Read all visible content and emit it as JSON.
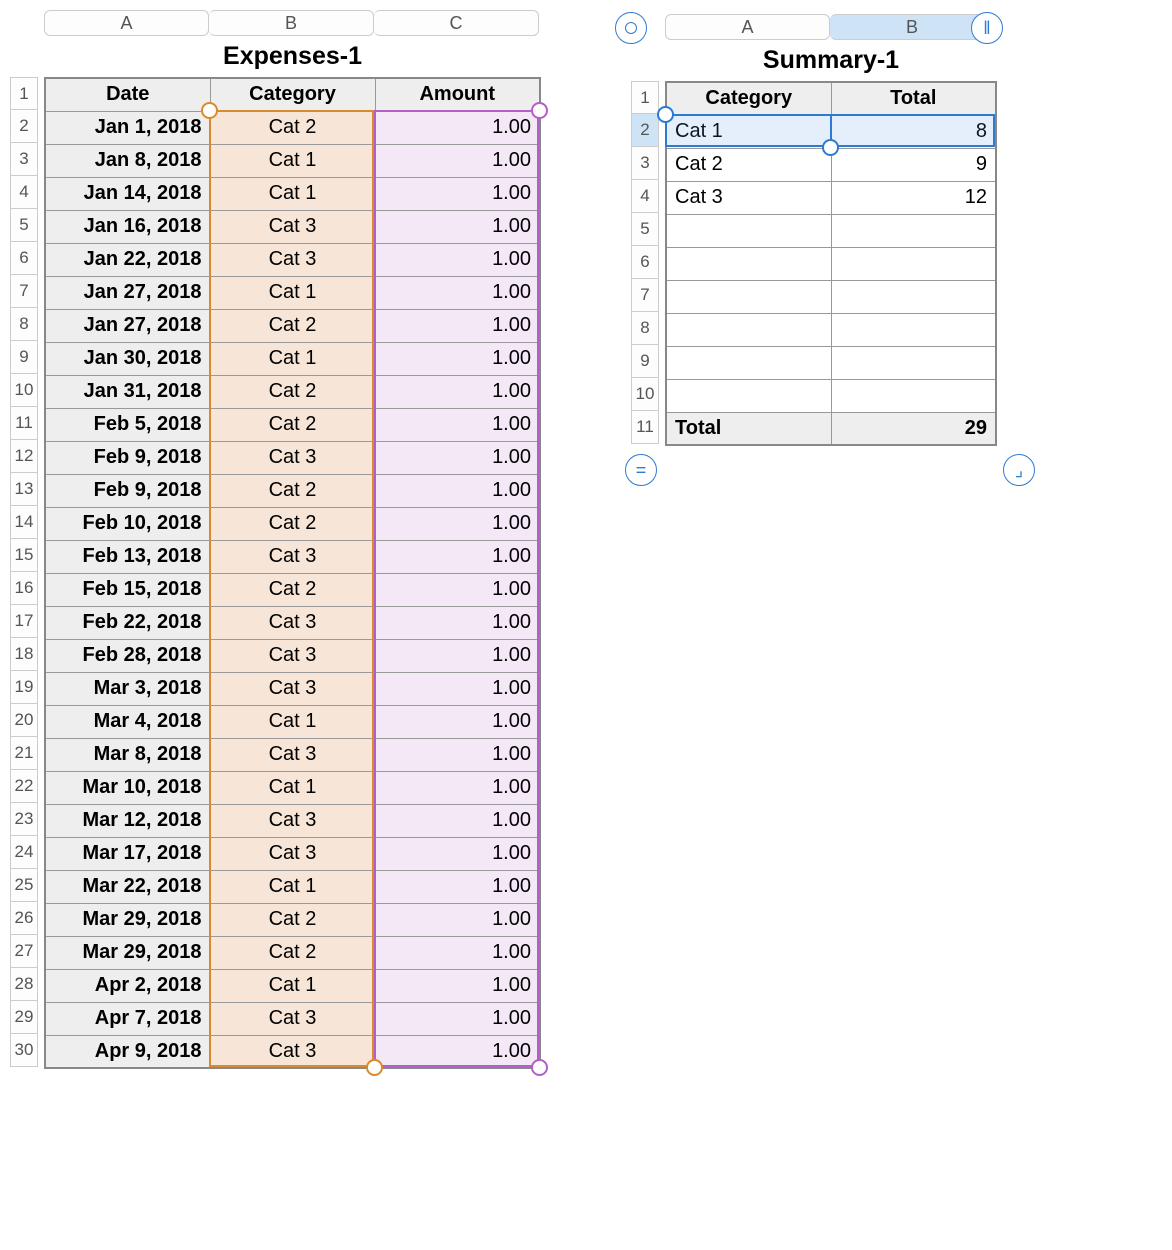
{
  "expenses": {
    "title": "Expenses-1",
    "colLetters": [
      "A",
      "B",
      "C"
    ],
    "headers": [
      "Date",
      "Category",
      "Amount"
    ],
    "rows": [
      {
        "date": "Jan 1, 2018",
        "cat": "Cat 2",
        "amt": "1.00"
      },
      {
        "date": "Jan 8, 2018",
        "cat": "Cat 1",
        "amt": "1.00"
      },
      {
        "date": "Jan 14, 2018",
        "cat": "Cat 1",
        "amt": "1.00"
      },
      {
        "date": "Jan 16, 2018",
        "cat": "Cat 3",
        "amt": "1.00"
      },
      {
        "date": "Jan 22, 2018",
        "cat": "Cat 3",
        "amt": "1.00"
      },
      {
        "date": "Jan 27, 2018",
        "cat": "Cat 1",
        "amt": "1.00"
      },
      {
        "date": "Jan 27, 2018",
        "cat": "Cat 2",
        "amt": "1.00"
      },
      {
        "date": "Jan 30, 2018",
        "cat": "Cat 1",
        "amt": "1.00"
      },
      {
        "date": "Jan 31, 2018",
        "cat": "Cat 2",
        "amt": "1.00"
      },
      {
        "date": "Feb 5, 2018",
        "cat": "Cat 2",
        "amt": "1.00"
      },
      {
        "date": "Feb 9, 2018",
        "cat": "Cat 3",
        "amt": "1.00"
      },
      {
        "date": "Feb 9, 2018",
        "cat": "Cat 2",
        "amt": "1.00"
      },
      {
        "date": "Feb 10, 2018",
        "cat": "Cat 2",
        "amt": "1.00"
      },
      {
        "date": "Feb 13, 2018",
        "cat": "Cat 3",
        "amt": "1.00"
      },
      {
        "date": "Feb 15, 2018",
        "cat": "Cat 2",
        "amt": "1.00"
      },
      {
        "date": "Feb 22, 2018",
        "cat": "Cat 3",
        "amt": "1.00"
      },
      {
        "date": "Feb 28, 2018",
        "cat": "Cat 3",
        "amt": "1.00"
      },
      {
        "date": "Mar 3, 2018",
        "cat": "Cat 3",
        "amt": "1.00"
      },
      {
        "date": "Mar 4, 2018",
        "cat": "Cat 1",
        "amt": "1.00"
      },
      {
        "date": "Mar 8, 2018",
        "cat": "Cat 3",
        "amt": "1.00"
      },
      {
        "date": "Mar 10, 2018",
        "cat": "Cat 1",
        "amt": "1.00"
      },
      {
        "date": "Mar 12, 2018",
        "cat": "Cat 3",
        "amt": "1.00"
      },
      {
        "date": "Mar 17, 2018",
        "cat": "Cat 3",
        "amt": "1.00"
      },
      {
        "date": "Mar 22, 2018",
        "cat": "Cat 1",
        "amt": "1.00"
      },
      {
        "date": "Mar 29, 2018",
        "cat": "Cat 2",
        "amt": "1.00"
      },
      {
        "date": "Mar 29, 2018",
        "cat": "Cat 2",
        "amt": "1.00"
      },
      {
        "date": "Apr 2, 2018",
        "cat": "Cat 1",
        "amt": "1.00"
      },
      {
        "date": "Apr 7, 2018",
        "cat": "Cat 3",
        "amt": "1.00"
      },
      {
        "date": "Apr 9, 2018",
        "cat": "Cat 3",
        "amt": "1.00"
      }
    ]
  },
  "summary": {
    "title": "Summary-1",
    "colLetters": [
      "A",
      "B"
    ],
    "headers": [
      "Category",
      "Total"
    ],
    "rows": [
      {
        "cat": "Cat 1",
        "tot": "8"
      },
      {
        "cat": "Cat 2",
        "tot": "9"
      },
      {
        "cat": "Cat 3",
        "tot": "12"
      }
    ],
    "emptyRows": 6,
    "footer": {
      "label": "Total",
      "value": "29"
    },
    "selectedRowIndex": 0,
    "selectedColIndex": 1
  }
}
